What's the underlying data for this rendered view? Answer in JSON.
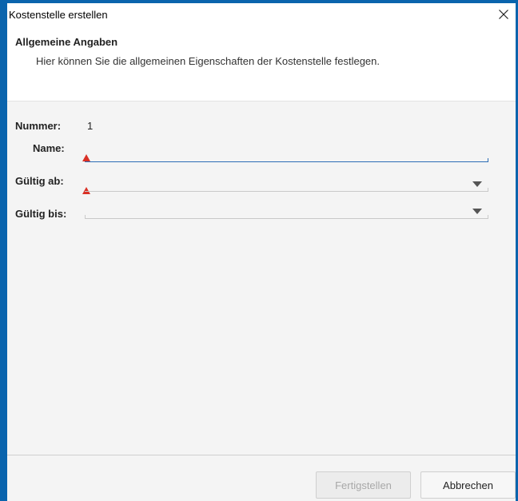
{
  "window": {
    "title": "Kostenstelle erstellen"
  },
  "header": {
    "title": "Allgemeine Angaben",
    "subtitle": "Hier können Sie die allgemeinen Eigenschaften der Kostenstelle festlegen."
  },
  "form": {
    "nummer_label": "Nummer:",
    "nummer_value": "1",
    "name_label": "Name:",
    "name_value": "",
    "gueltig_ab_label": "Gültig ab:",
    "gueltig_ab_value": "",
    "gueltig_bis_label": "Gültig bis:",
    "gueltig_bis_value": ""
  },
  "footer": {
    "finish_label": "Fertigstellen",
    "cancel_label": "Abbrechen"
  },
  "colors": {
    "window_border": "#0a64ad",
    "warning": "#d93025",
    "active_underline": "#2d6db5"
  }
}
